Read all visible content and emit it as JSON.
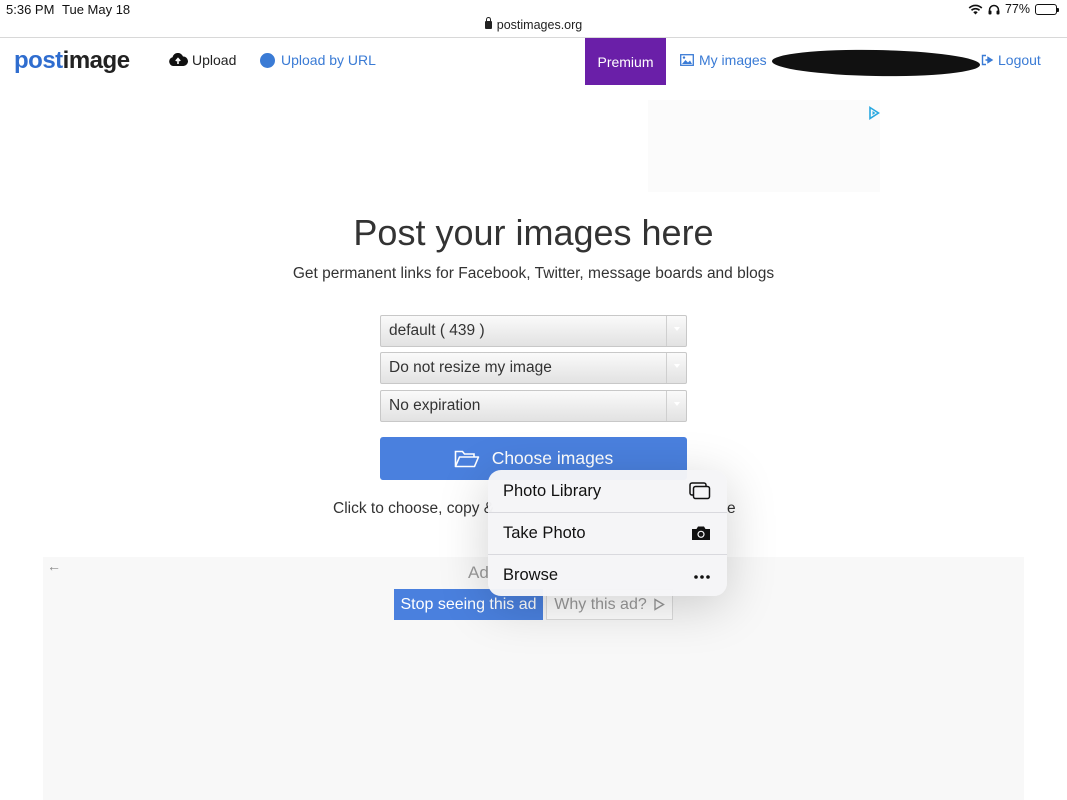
{
  "status_bar": {
    "time": "5:36 PM",
    "date": "Tue May 18",
    "url": "postimages.org",
    "battery": "77%",
    "battery_level": 0.77
  },
  "nav": {
    "logo_post": "post",
    "logo_image": "image",
    "upload": "Upload",
    "upload_by_url": "Upload by URL",
    "premium": "Premium",
    "my_images": "My images",
    "logout": "Logout"
  },
  "hero": {
    "title": "Post your images here",
    "subtitle": "Get permanent links for Facebook, Twitter, message boards and blogs"
  },
  "form": {
    "gallery_select": "default ( 439 )",
    "resize_select": "Do not resize my image",
    "expiration_select": "No expiration",
    "choose_button": "Choose images",
    "hint_start": "Click to choose, copy &",
    "hint_end": "e"
  },
  "ad": {
    "label": "Ad",
    "stop_seeing": "Stop seeing this ad",
    "why": "Why this ad?"
  },
  "popover": {
    "items": [
      {
        "label": "Photo Library",
        "icon": "photo-library-icon"
      },
      {
        "label": "Take Photo",
        "icon": "camera-icon"
      },
      {
        "label": "Browse",
        "icon": "more-icon"
      }
    ]
  }
}
